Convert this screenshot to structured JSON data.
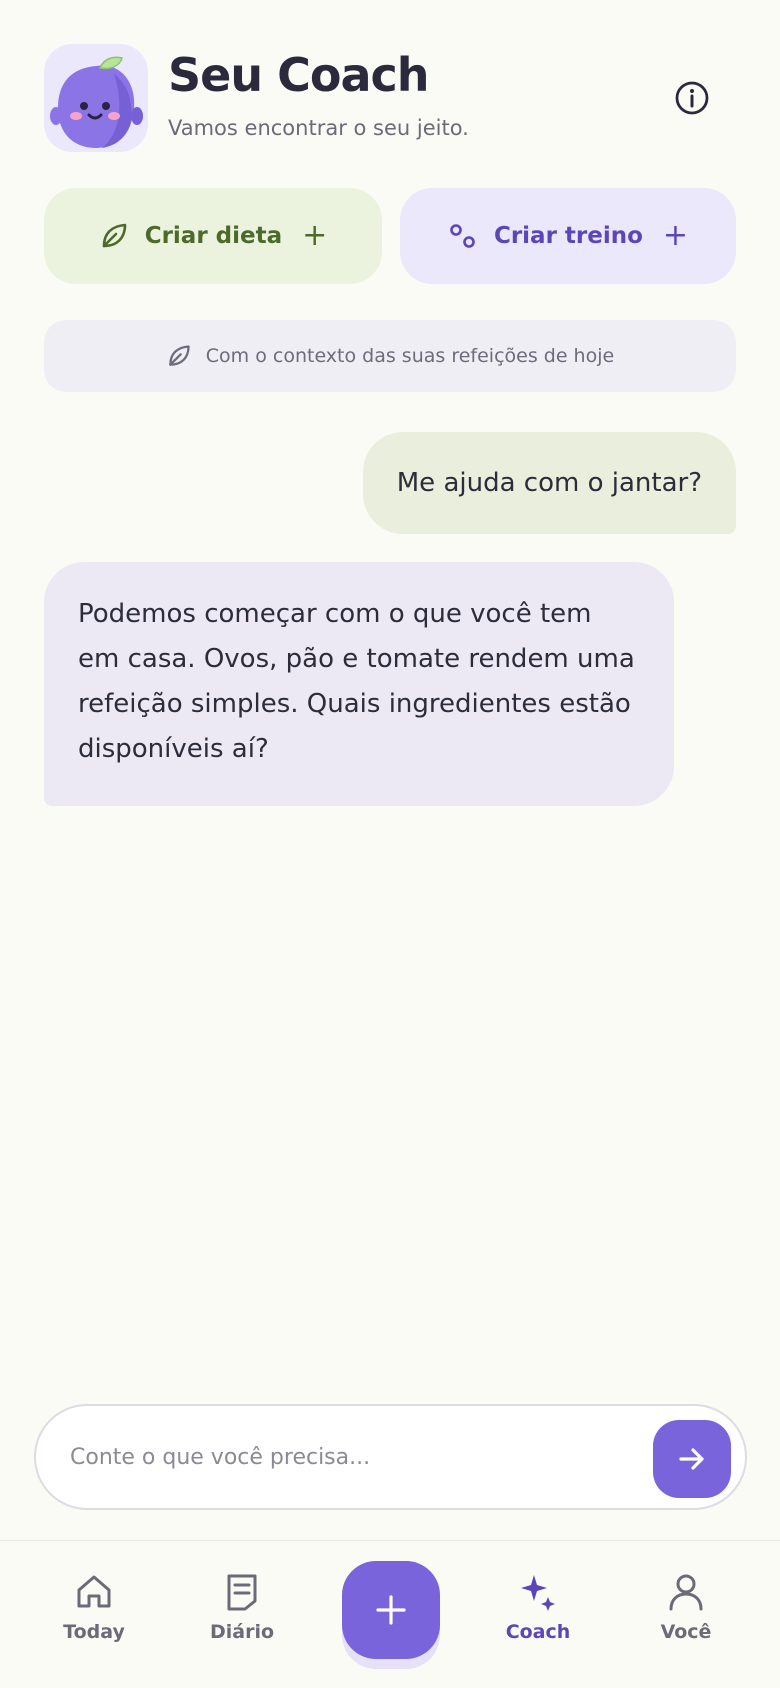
{
  "header": {
    "title": "Seu Coach",
    "subtitle": "Vamos encontrar o seu jeito."
  },
  "icons": {
    "avatar": "plum-mascot-avatar",
    "info": "info-icon",
    "leaf": "leaf-icon",
    "workout": "workout-circles-icon",
    "send": "arrow-right-icon"
  },
  "actions": {
    "diet_label": "Criar dieta",
    "workout_label": "Criar treino"
  },
  "context": {
    "text": "Com o contexto das suas refeições de hoje"
  },
  "messages": [
    {
      "role": "user",
      "text": "Me ajuda com o jantar?"
    },
    {
      "role": "coach",
      "text": "Podemos começar com o que você tem em casa. Ovos, pão e tomate rendem uma refeição simples. Quais ingredientes estão disponíveis aí?"
    }
  ],
  "composer": {
    "placeholder": "Conte o que você precisa..."
  },
  "tabs": [
    {
      "label": "Today",
      "icon": "home-icon"
    },
    {
      "label": "Diário",
      "icon": "journal-icon"
    },
    {
      "label": "Coach",
      "icon": "sparkle-icon",
      "active": true
    },
    {
      "label": "Você",
      "icon": "person-icon"
    }
  ],
  "colors": {
    "accent": "#7a64dc",
    "diet": "#4d6a2a",
    "workout": "#5b45b8",
    "background": "#fbfbf6"
  }
}
